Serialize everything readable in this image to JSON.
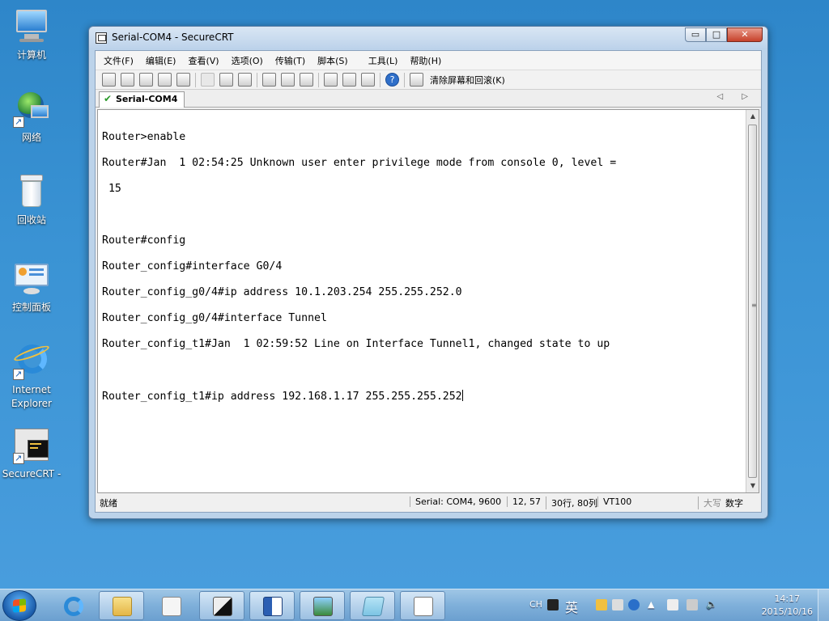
{
  "desktop": {
    "icons": [
      {
        "label": "计算机"
      },
      {
        "label": "网络"
      },
      {
        "label": "回收站"
      },
      {
        "label": "控制面板"
      },
      {
        "label": "Internet Explorer"
      },
      {
        "label": "SecureCRT -"
      }
    ]
  },
  "window": {
    "title": "Serial-COM4 - SecureCRT",
    "controls": {
      "minimize": "▭",
      "maximize": "□",
      "close": "✕"
    },
    "menu": [
      "文件(F)",
      "编辑(E)",
      "查看(V)",
      "选项(O)",
      "传输(T)",
      "脚本(S)",
      "工具(L)",
      "帮助(H)"
    ],
    "toolbar": {
      "clear_label": "清除屏幕和回滚(K)",
      "help_glyph": "?"
    },
    "tab": {
      "label": "Serial-COM4",
      "check": "✔",
      "arrows": "◁ ▷"
    },
    "terminal": {
      "lines": [
        "Router>enable",
        "Router#Jan  1 02:54:25 Unknown user enter privilege mode from console 0, level =",
        " 15",
        "",
        "Router#config",
        "Router_config#interface G0/4",
        "Router_config_g0/4#ip address 10.1.203.254 255.255.252.0",
        "Router_config_g0/4#interface Tunnel",
        "Router_config_t1#Jan  1 02:59:52 Line on Interface Tunnel1, changed state to up",
        "",
        "Router_config_t1#ip address 192.168.1.17 255.255.255.252"
      ]
    },
    "status": {
      "ready": "就绪",
      "connection": "Serial: COM4, 9600",
      "cursor_pos": "12,  57",
      "size": "30行, 80列",
      "emulation": "VT100",
      "caps": "大写",
      "num": "数字"
    }
  },
  "taskbar": {
    "tray": {
      "lang": "CH",
      "ime": "英"
    },
    "clock": {
      "time": "14:17",
      "date": "2015/10/16"
    }
  },
  "colors": {
    "desktop": "#3a93d4",
    "taskbar": "#7fb0da",
    "window_frame": "#bcd3ea"
  }
}
